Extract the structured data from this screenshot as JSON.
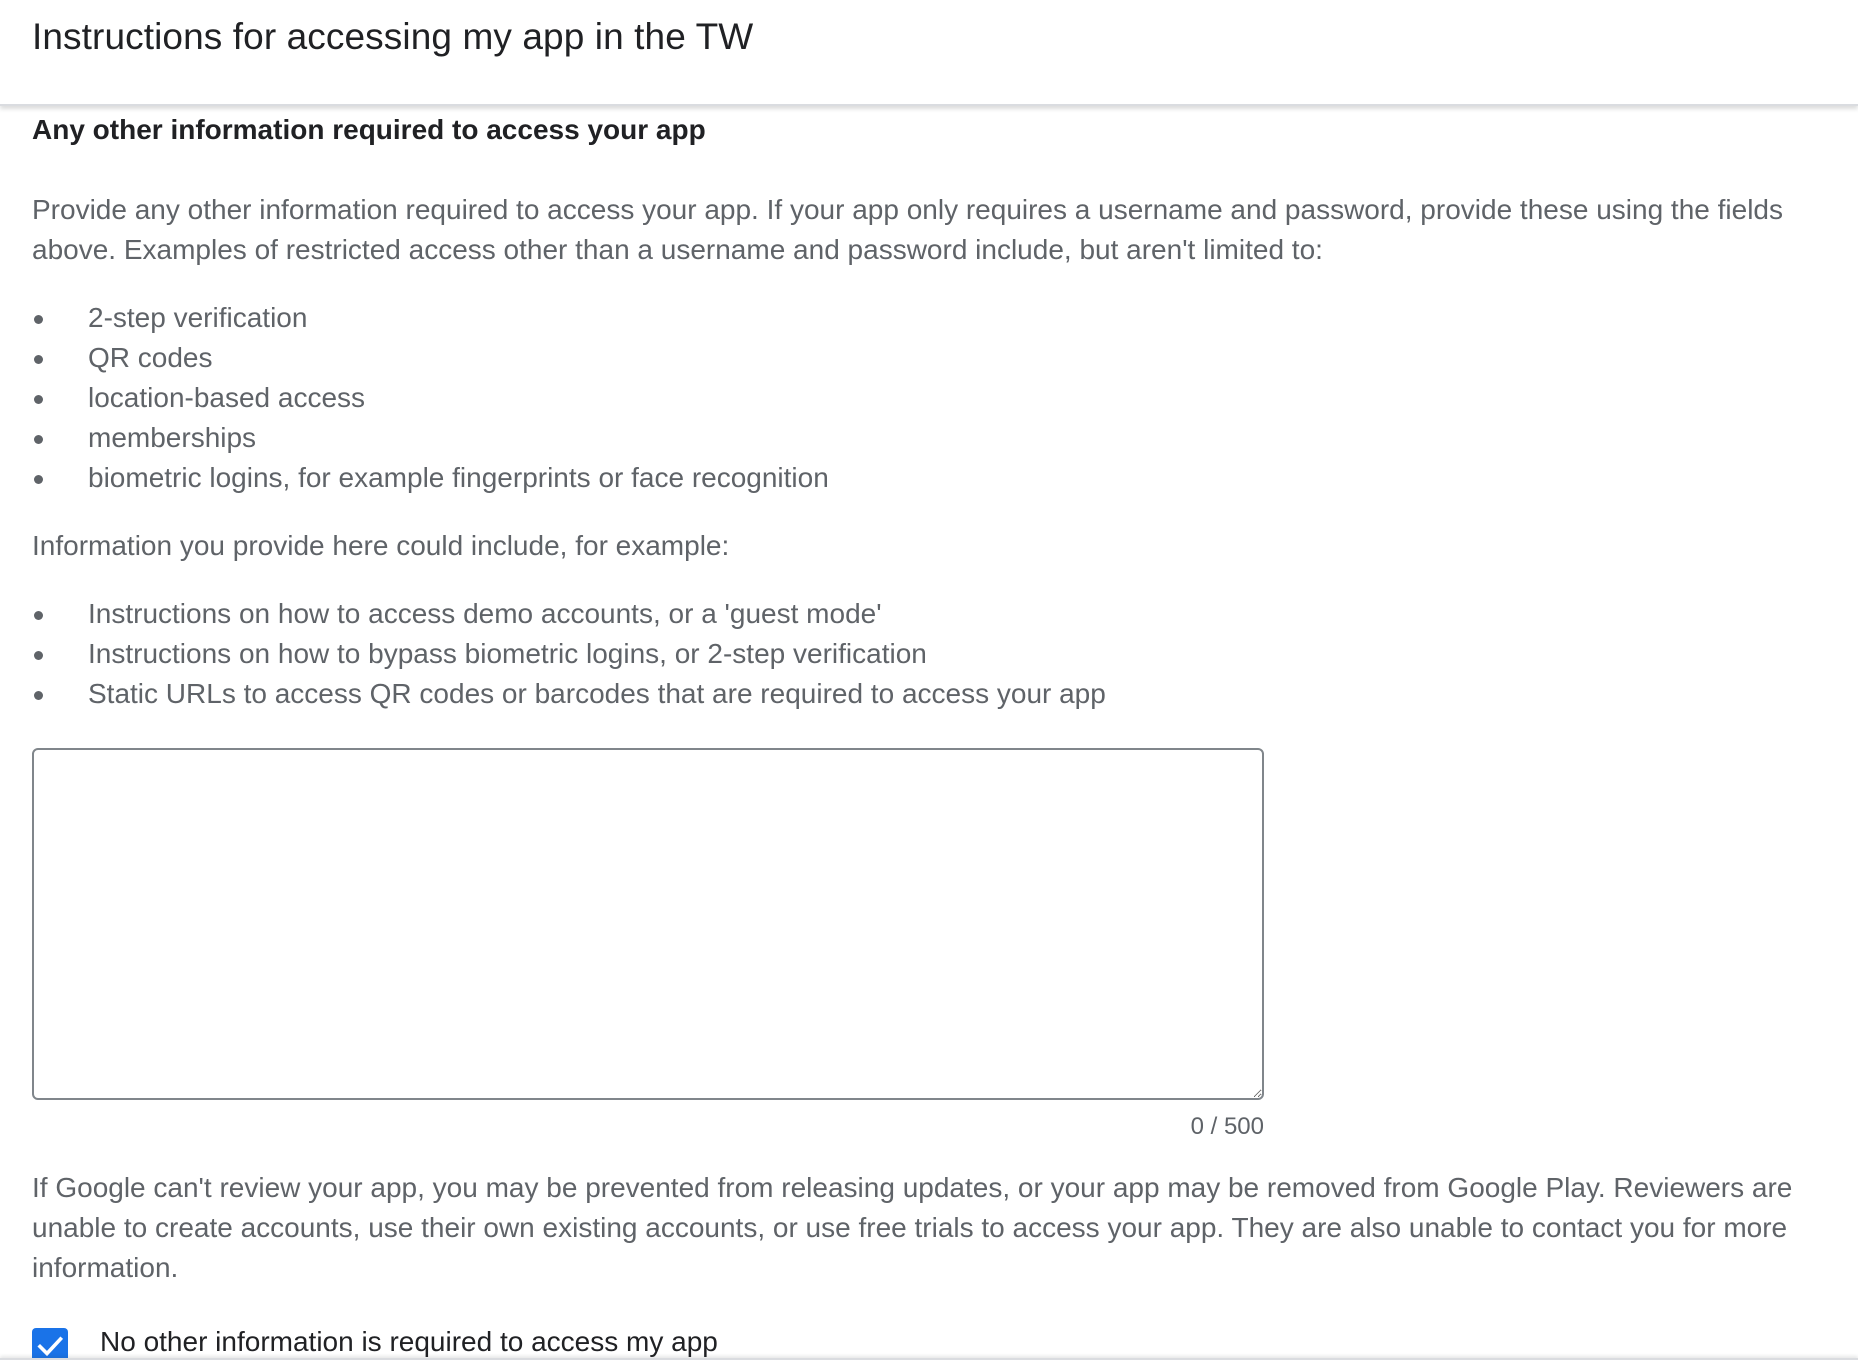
{
  "dialog": {
    "title": "Instructions for accessing my app in the TW"
  },
  "section": {
    "title": "Any other information required to access your app",
    "intro": "Provide any other information required to access your app. If your app only requires a username and password, provide these using the fields above. Examples of restricted access other than a username and password include, but aren't limited to:",
    "examples": [
      "2-step verification",
      "QR codes",
      "location-based access",
      "memberships",
      "biometric logins, for example fingerprints or face recognition"
    ],
    "info_intro": "Information you provide here could include, for example:",
    "info_examples": [
      "Instructions on how to access demo accounts, or a 'guest mode'",
      "Instructions on how to bypass biometric logins, or 2-step verification",
      "Static URLs to access QR codes or barcodes that are required to access your app"
    ],
    "textarea": {
      "value": "",
      "placeholder": ""
    },
    "char_count": "0 / 500",
    "warning": "If Google can't review your app, you may be prevented from releasing updates, or your app may be removed from Google Play. Reviewers are unable to create accounts, use their own existing accounts, or use free trials to access your app. They are also unable to contact you for more information."
  },
  "checkbox": {
    "label": "No other information is required to access my app",
    "checked": true,
    "color": "#1a73e8"
  },
  "icons": {
    "checkbox": "checkmark-icon",
    "bullet": "bullet-icon"
  }
}
